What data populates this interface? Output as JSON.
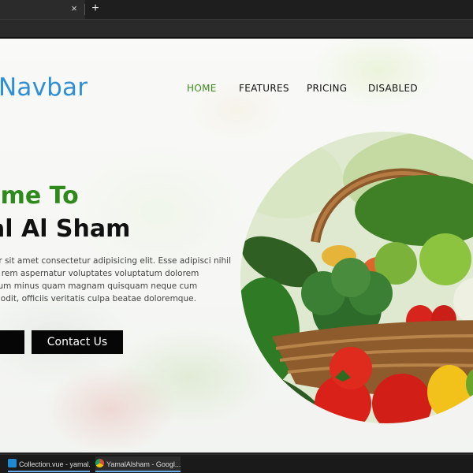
{
  "browser": {
    "tab_close": "×",
    "new_tab": "+"
  },
  "page": {
    "brand": "Navbar",
    "nav": [
      {
        "label": "HOME",
        "active": true
      },
      {
        "label": "FEATURES",
        "active": false
      },
      {
        "label": "PRICING",
        "active": false
      },
      {
        "label": "DISABLED",
        "active": false
      }
    ],
    "hero": {
      "title_line1": "ome To",
      "title_line2": "al Al Sham",
      "paragraph_lines": [
        "or sit amet consectetur adipisicing elit. Esse adipisci nihil",
        "e rem aspernatur voluptates voluptatum dolorem",
        "sum minus quam magnam quisquam neque cum",
        "s odit, officiis veritatis culpa beatae doloremque."
      ],
      "contact_button": "Contact Us"
    },
    "colors": {
      "brand": "#2f8fd6",
      "accent_green": "#2e8a1a",
      "button_bg": "#060606"
    }
  },
  "taskbar": {
    "items": [
      {
        "label": "Collection.vue - yamal...",
        "icon": "vscode-icon"
      },
      {
        "label": "YamalAlsham - Googl...",
        "icon": "chrome-icon"
      }
    ]
  }
}
